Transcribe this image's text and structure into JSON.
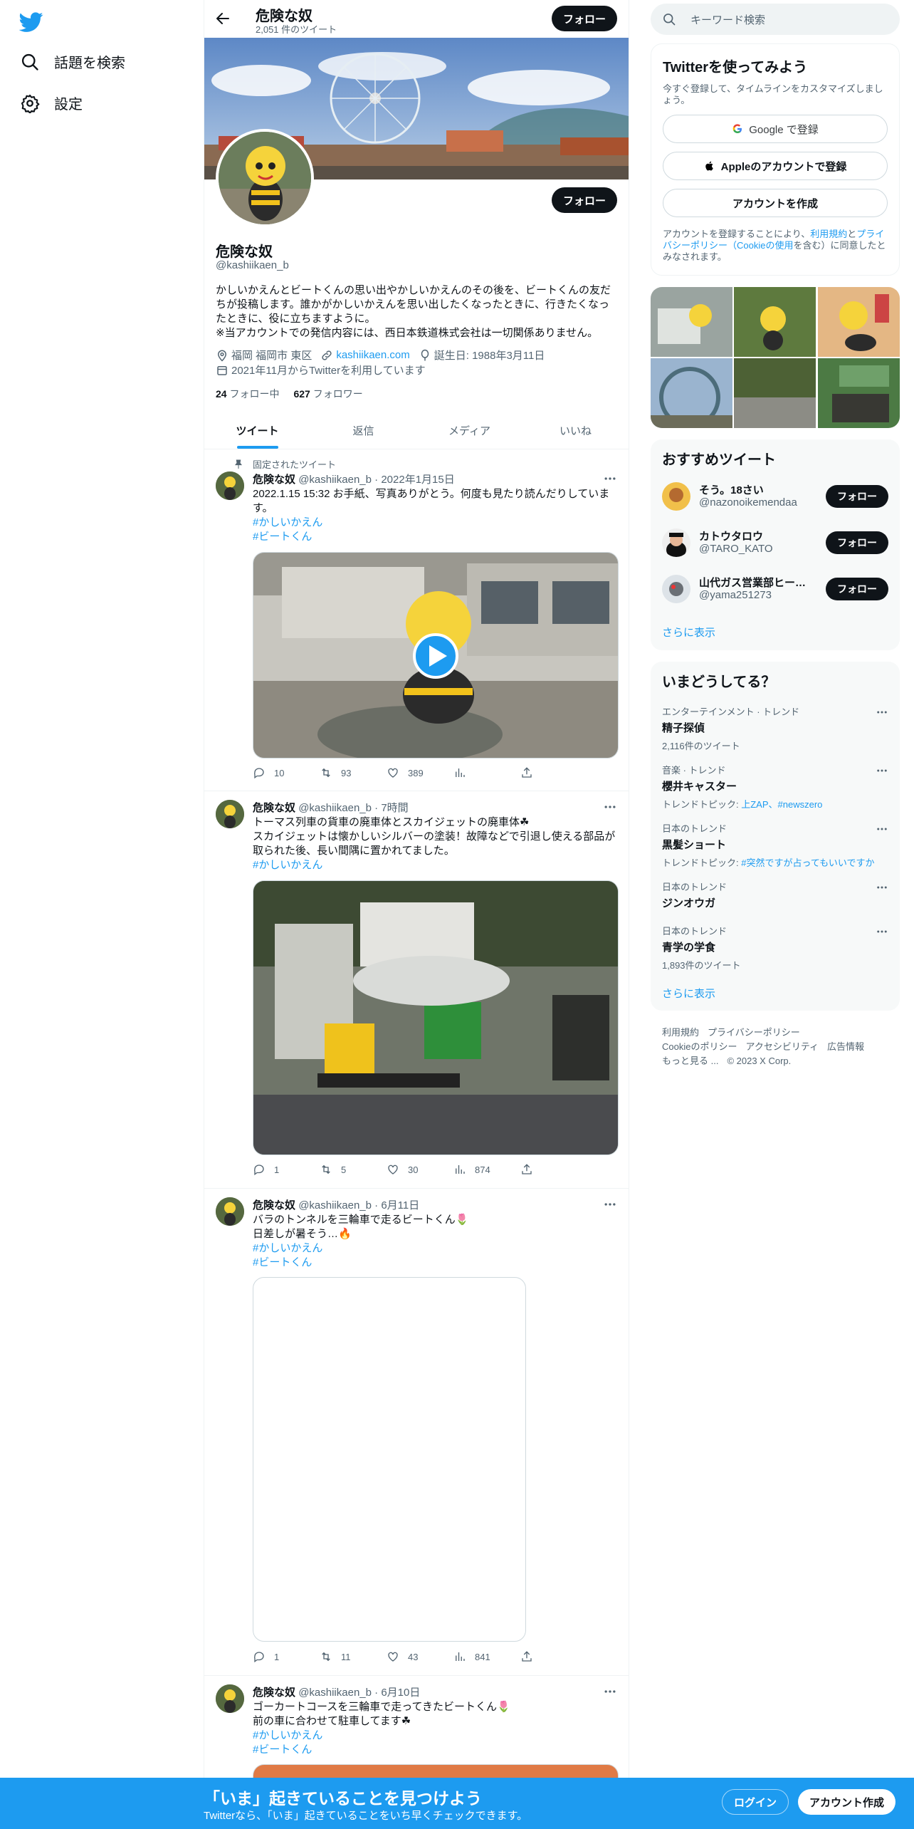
{
  "nav": {
    "search_label": "話題を検索",
    "settings_label": "設定"
  },
  "header": {
    "name": "危険な奴",
    "tweet_count": "2,051 件のツイート",
    "follow_label": "フォロー"
  },
  "profile": {
    "name": "危険な奴",
    "handle": "@kashiikaen_b",
    "follow_label": "フォロー",
    "bio": "かしいかえんとビートくんの思い出やかしいかえんのその後を、ビートくんの友だちが投稿します。誰かがかしいかえんを思い出したくなったときに、行きたくなったときに、役に立ちますように。\n※当アカウントでの発信内容には、西日本鉄道株式会社は一切関係ありません。",
    "location": "福岡 福岡市 東区",
    "website": "kashiikaen.com",
    "birthday": "誕生日: 1988年3月11日",
    "joined": "2021年11月からTwitterを利用しています",
    "following_count": "24",
    "following_label": "フォロー中",
    "followers_count": "627",
    "followers_label": "フォロワー"
  },
  "tabs": [
    "ツイート",
    "返信",
    "メディア",
    "いいね"
  ],
  "pinned_label": "固定されたツイート",
  "tweets": [
    {
      "name": "危険な奴",
      "handle": "@kashiikaen_b",
      "time": "2022年1月15日",
      "lines": [
        "2022.1.15 15:32 お手紙、写真ありがとう。何度も見たり読んだりしています。"
      ],
      "tags": [
        "#かしいかえん",
        "#ビートくん"
      ],
      "replies": "10",
      "retweets": "93",
      "likes": "389",
      "views": ""
    },
    {
      "name": "危険な奴",
      "handle": "@kashiikaen_b",
      "time": "7時間",
      "lines": [
        "トーマス列車の貨車の廃車体とスカイジェットの廃車体☘",
        "スカイジェットは懐かしいシルバーの塗装！故障などで引退し使える部品が取られた後、長い間隅に置かれてました。"
      ],
      "tags": [
        "#かしいかえん"
      ],
      "replies": "1",
      "retweets": "5",
      "likes": "30",
      "views": "874"
    },
    {
      "name": "危険な奴",
      "handle": "@kashiikaen_b",
      "time": "6月11日",
      "lines": [
        "バラのトンネルを三輪車で走るビートくん🌷",
        "日差しが暑そう…🔥"
      ],
      "tags": [
        "#かしいかえん",
        "#ビートくん"
      ],
      "replies": "1",
      "retweets": "11",
      "likes": "43",
      "views": "841"
    },
    {
      "name": "危険な奴",
      "handle": "@kashiikaen_b",
      "time": "6月10日",
      "lines": [
        "ゴーカートコースを三輪車で走ってきたビートくん🌷",
        "前の車に合わせて駐車してます☘"
      ],
      "tags": [
        "#かしいかえん",
        "#ビートくん"
      ],
      "replies": "",
      "retweets": "",
      "likes": "",
      "views": ""
    }
  ],
  "search": {
    "placeholder": "キーワード検索"
  },
  "signup": {
    "title": "Twitterを使ってみよう",
    "subtitle": "今すぐ登録して、タイムラインをカスタマイズしましょう。",
    "google": "Google で登録",
    "apple": "Appleのアカウントで登録",
    "create": "アカウントを作成",
    "legal_pre": "アカウントを登録することにより、",
    "legal_terms": "利用規約",
    "legal_and": "と",
    "legal_privacy": "プライバシーポリシー",
    "legal_cookie": "（Cookieの使用",
    "legal_post": "を含む）に同意したとみなされます。"
  },
  "recommended": {
    "title": "おすすめツイート",
    "users": [
      {
        "name": "そう。18さい",
        "handle": "@nazonoikemendaa",
        "follow": "フォロー"
      },
      {
        "name": "カトウタロウ",
        "handle": "@TARO_KATO",
        "follow": "フォロー"
      },
      {
        "name": "山代ガス営業部ヒーロー",
        "handle": "@yama251273",
        "follow": "フォロー"
      }
    ],
    "show_more": "さらに表示"
  },
  "trends": {
    "title": "いまどうしてる？",
    "items": [
      {
        "context": "エンターテインメント · トレンド",
        "name": "精子探偵",
        "extra": "2,116件のツイート"
      },
      {
        "context": "音楽 · トレンド",
        "name": "櫻井キャスター",
        "extra_pre": "トレンドトピック: ",
        "extra_links": "上ZAP、#newszero"
      },
      {
        "context": "日本のトレンド",
        "name": "黒髪ショート",
        "extra_pre": "トレンドトピック: ",
        "extra_links": "#突然ですが占ってもいいですか"
      },
      {
        "context": "日本のトレンド",
        "name": "ジンオウガ"
      },
      {
        "context": "日本のトレンド",
        "name": "青学の学食",
        "extra": "1,893件のツイート"
      }
    ],
    "show_more": "さらに表示"
  },
  "footer": {
    "links": [
      "利用規約",
      "プライバシーポリシー",
      "Cookieのポリシー",
      "アクセシビリティ",
      "広告情報",
      "もっと見る ...",
      "© 2023 X Corp."
    ]
  },
  "bottom": {
    "title": "「いま」起きていることを見つけよう",
    "subtitle": "Twitterなら、「いま」起きていることをいち早くチェックできます。",
    "login": "ログイン",
    "signup": "アカウント作成"
  },
  "colors": {
    "accent": "#1d9bf0",
    "dark": "#0f1419",
    "muted": "#536471"
  }
}
